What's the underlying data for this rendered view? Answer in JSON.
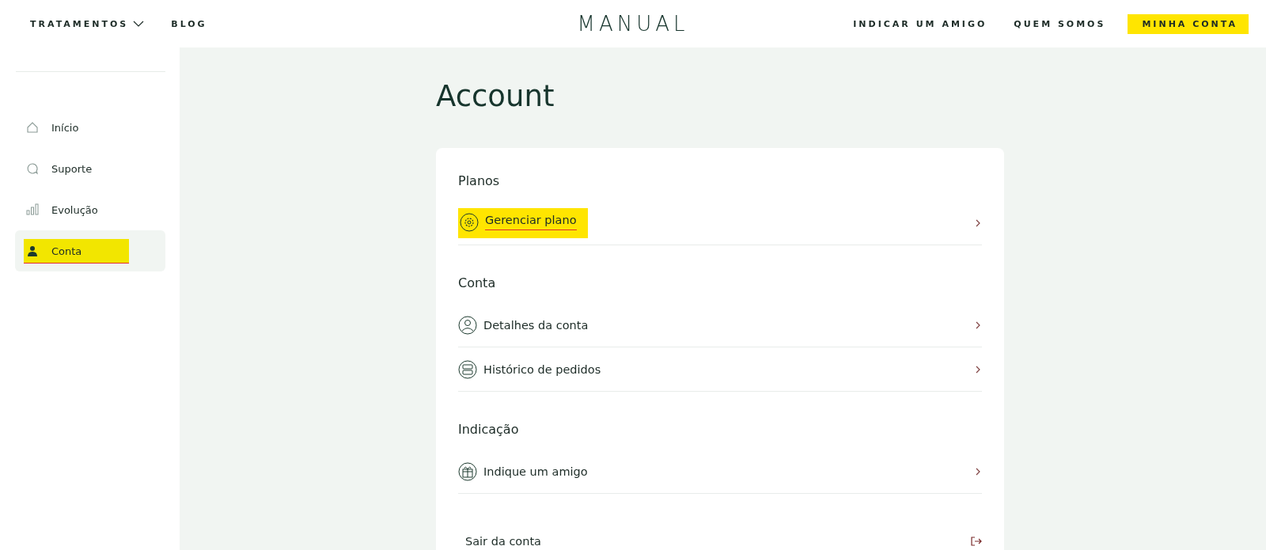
{
  "header": {
    "left_nav": [
      {
        "label": "TRATAMENTOS",
        "dropdown": true
      },
      {
        "label": "BLOG",
        "dropdown": false
      }
    ],
    "logo": "MANUAL",
    "right_nav": [
      {
        "label": "INDICAR UM AMIGO",
        "highlighted": false
      },
      {
        "label": "QUEM SOMOS",
        "highlighted": false
      },
      {
        "label": "MINHA CONTA",
        "highlighted": true
      }
    ]
  },
  "sidebar": {
    "items": [
      {
        "label": "Início",
        "selected": false,
        "highlighted": false
      },
      {
        "label": "Suporte",
        "selected": false,
        "highlighted": false
      },
      {
        "label": "Evolução",
        "selected": false,
        "highlighted": false
      },
      {
        "label": "Conta",
        "selected": true,
        "highlighted": true
      }
    ]
  },
  "page_title": "Account",
  "sections": [
    {
      "title": "Planos",
      "items": [
        {
          "label": "Gerenciar plano",
          "highlighted": true
        }
      ]
    },
    {
      "title": "Conta",
      "items": [
        {
          "label": "Detalhes da conta",
          "highlighted": false
        },
        {
          "label": "Histórico de pedidos",
          "highlighted": false
        }
      ]
    },
    {
      "title": "Indicação",
      "items": [
        {
          "label": "Indique um amigo",
          "highlighted": false
        }
      ]
    }
  ],
  "logout": {
    "label": "Sair da conta"
  }
}
